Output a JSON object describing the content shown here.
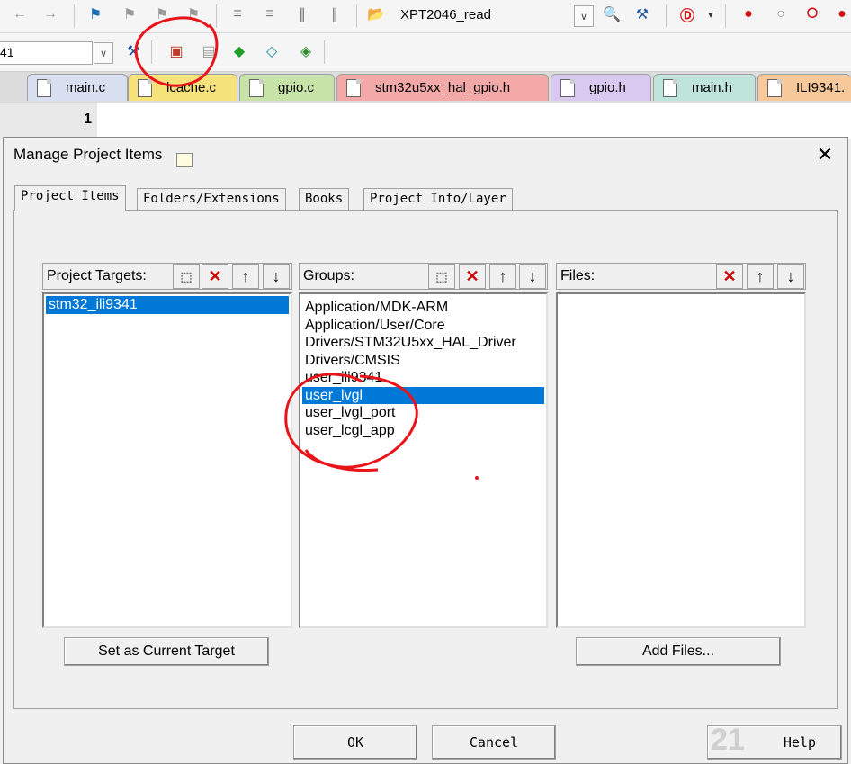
{
  "toolbar1": {
    "project_combo_value": "XPT2046_read"
  },
  "toolbar2": {
    "target_combo_value": "41"
  },
  "file_tabs": [
    {
      "label": "main.c",
      "color": "#d8dff0"
    },
    {
      "label": "lcache.c",
      "color": "#f6e27a"
    },
    {
      "label": "gpio.c",
      "color": "#c7e3a8"
    },
    {
      "label": "stm32u5xx_hal_gpio.h",
      "color": "#f4a9a9"
    },
    {
      "label": "gpio.h",
      "color": "#d9c8ef"
    },
    {
      "label": "main.h",
      "color": "#bfe4da"
    },
    {
      "label": "ILI9341.",
      "color": "#f6c89a"
    }
  ],
  "editor": {
    "line_number": "1"
  },
  "dialog": {
    "title": "Manage Project Items",
    "tabs": [
      "Project Items",
      "Folders/Extensions",
      "Books",
      "Project Info/Layer"
    ],
    "targets": {
      "header": "Project Targets:",
      "items": [
        "stm32_ili9341"
      ],
      "selected": 0,
      "button_label": "Set as Current Target"
    },
    "groups": {
      "header": "Groups:",
      "items": [
        "Application/MDK-ARM",
        "Application/User/Core",
        "Drivers/STM32U5xx_HAL_Driver",
        "Drivers/CMSIS",
        "user_ili9341",
        "user_lvgl",
        "user_lvgl_port",
        "user_lcgl_app"
      ],
      "selected": 5
    },
    "files": {
      "header": "Files:",
      "items": [],
      "button_label": "Add Files..."
    },
    "ok_label": "OK",
    "cancel_label": "Cancel",
    "help_label": "Help"
  },
  "colors": {
    "selection": "#0078d7",
    "annotation": "#e8141a"
  }
}
